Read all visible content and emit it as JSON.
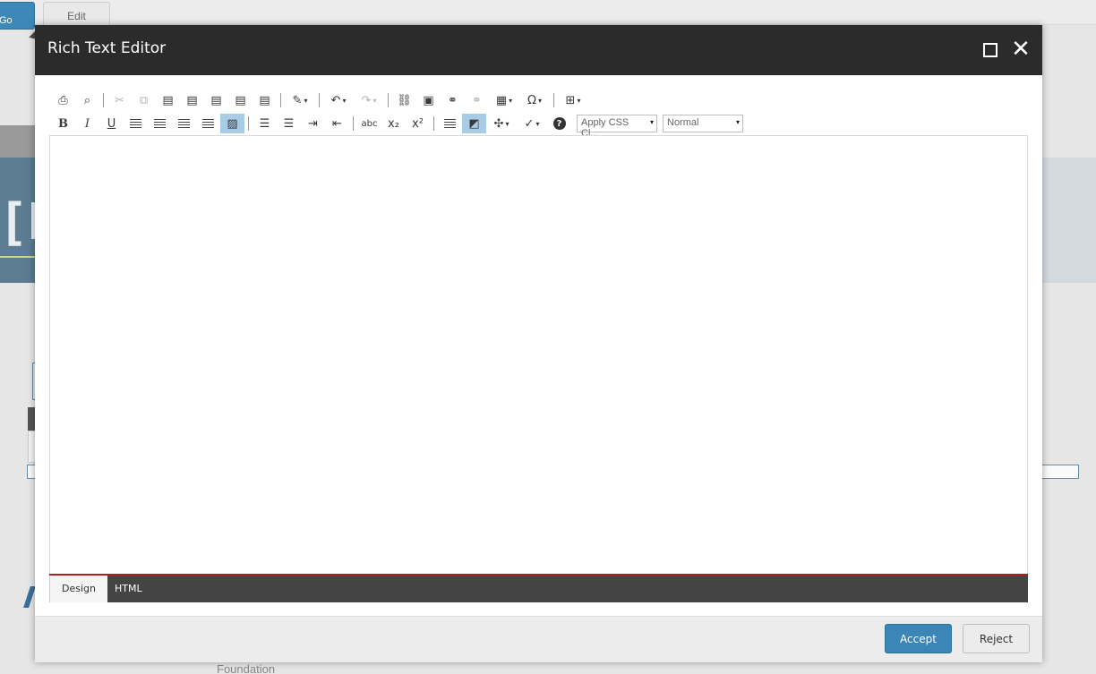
{
  "background": {
    "go_button_label": "Go",
    "edit_tab_label": "Edit",
    "banner_glyph": "[N",
    "footer_fragment": "Foundation"
  },
  "dialog": {
    "title": "Rich Text Editor",
    "maximize_icon": "maximize-icon",
    "close_icon": "close-icon",
    "close_glyph": "✕"
  },
  "toolbar": {
    "row1": [
      {
        "name": "print-icon",
        "glyph": "⎙"
      },
      {
        "name": "find-replace-icon",
        "glyph": "⌕"
      },
      {
        "name": "cut-icon",
        "glyph": "✂",
        "disabled": true
      },
      {
        "name": "copy-icon",
        "glyph": "⧉",
        "disabled": true
      },
      {
        "name": "paste-icon",
        "glyph": "▤"
      },
      {
        "name": "paste-from-word-icon",
        "glyph": "▤"
      },
      {
        "name": "paste-from-word-strip-icon",
        "glyph": "▤"
      },
      {
        "name": "paste-plain-text-icon",
        "glyph": "▤"
      },
      {
        "name": "paste-as-html-icon",
        "glyph": "▤"
      },
      {
        "name": "format-stripper-icon",
        "glyph": "✎",
        "drop": true
      },
      {
        "name": "undo-icon",
        "glyph": "↶",
        "drop": true
      },
      {
        "name": "redo-icon",
        "glyph": "↷",
        "drop": true,
        "disabled": true
      },
      {
        "name": "insert-link-icon",
        "glyph": "⛓"
      },
      {
        "name": "insert-media-icon",
        "glyph": "▣"
      },
      {
        "name": "hyperlink-manager-icon",
        "glyph": "⚭"
      },
      {
        "name": "remove-link-icon",
        "glyph": "⚭",
        "disabled": true
      },
      {
        "name": "insert-table-icon",
        "glyph": "▦",
        "drop": true
      },
      {
        "name": "insert-symbol-icon",
        "glyph": "Ω",
        "drop": true
      },
      {
        "name": "insert-snippet-icon",
        "glyph": "⊞",
        "drop": true
      }
    ],
    "row2": [
      {
        "name": "bold-icon",
        "glyph": "B",
        "style": "b"
      },
      {
        "name": "italic-icon",
        "glyph": "I",
        "style": "i"
      },
      {
        "name": "underline-icon",
        "glyph": "U",
        "style": "u"
      },
      {
        "name": "align-left-icon",
        "glyph": "",
        "style": "lines"
      },
      {
        "name": "align-center-icon",
        "glyph": "",
        "style": "lines"
      },
      {
        "name": "align-right-icon",
        "glyph": "",
        "style": "lines"
      },
      {
        "name": "justify-icon",
        "glyph": "",
        "style": "lines"
      },
      {
        "name": "remove-alignment-icon",
        "glyph": "▨",
        "active": true
      },
      {
        "name": "numbered-list-icon",
        "glyph": "☰"
      },
      {
        "name": "bulleted-list-icon",
        "glyph": "☰"
      },
      {
        "name": "indent-icon",
        "glyph": "⇥"
      },
      {
        "name": "outdent-icon",
        "glyph": "⇤"
      },
      {
        "name": "strikethrough-icon",
        "glyph": "abc",
        "style": "sm"
      },
      {
        "name": "subscript-icon",
        "glyph": "x₂"
      },
      {
        "name": "superscript-icon",
        "glyph": "x²"
      },
      {
        "name": "paragraph-style-icon",
        "glyph": "",
        "style": "lines"
      },
      {
        "name": "toggle-borders-icon",
        "glyph": "◩",
        "active": true
      },
      {
        "name": "insert-component-icon",
        "glyph": "✣",
        "drop": true
      },
      {
        "name": "spellcheck-icon",
        "glyph": "✓",
        "drop": true
      },
      {
        "name": "help-icon",
        "glyph": "?",
        "style": "help"
      }
    ],
    "css_class_dropdown": "Apply CSS Cl...",
    "paragraph_format_dropdown": "Normal"
  },
  "mode_tabs": {
    "design": "Design",
    "html": "HTML"
  },
  "footer": {
    "accept_label": "Accept",
    "reject_label": "Reject"
  }
}
